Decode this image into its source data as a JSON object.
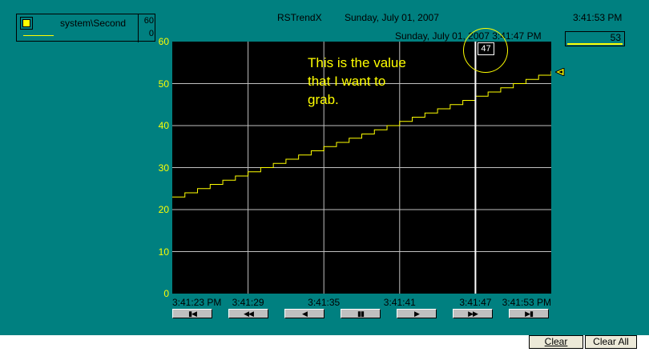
{
  "header": {
    "title": "RSTrendX",
    "date": "Sunday, July 01, 2007",
    "current_time": "3:41:53 PM",
    "cursor_timestamp": "Sunday, July 01, 2007 3:41:47 PM"
  },
  "legend": {
    "tag_name": "system\\Second",
    "scale_max": "60",
    "scale_min": "0",
    "pen_color": "#ffff00"
  },
  "current_value": "53",
  "cursor_value": "47",
  "annotation": [
    "This is the value",
    "that I want to",
    "grab."
  ],
  "y_axis_labels": [
    "60",
    "50",
    "40",
    "30",
    "20",
    "10",
    "0"
  ],
  "x_axis_labels": [
    "3:41:23 PM",
    "3:41:29",
    "3:41:35",
    "3:41:41",
    "3:41:47",
    "3:41:53 PM"
  ],
  "nav_buttons": [
    {
      "name": "first-page-button",
      "icon": "skip-to-start-icon"
    },
    {
      "name": "page-back-button",
      "icon": "fast-rewind-icon"
    },
    {
      "name": "step-back-button",
      "icon": "step-back-icon"
    },
    {
      "name": "pause-button",
      "icon": "pause-icon"
    },
    {
      "name": "step-forward-button",
      "icon": "step-forward-icon"
    },
    {
      "name": "page-forward-button",
      "icon": "fast-forward-icon"
    },
    {
      "name": "last-page-button",
      "icon": "skip-to-end-icon"
    }
  ],
  "toolbar": {
    "clear_label": "Clear",
    "clear_all_label": "Clear All"
  },
  "colors": {
    "background": "#008080",
    "plot_background": "#000000",
    "trend_pen": "#ffff00",
    "grid": "#c0c0c0",
    "annotation": "#ffff00"
  },
  "chart_data": {
    "type": "line",
    "x": [
      "3:41:23",
      "3:41:24",
      "3:41:25",
      "3:41:26",
      "3:41:27",
      "3:41:28",
      "3:41:29",
      "3:41:30",
      "3:41:31",
      "3:41:32",
      "3:41:33",
      "3:41:34",
      "3:41:35",
      "3:41:36",
      "3:41:37",
      "3:41:38",
      "3:41:39",
      "3:41:40",
      "3:41:41",
      "3:41:42",
      "3:41:43",
      "3:41:44",
      "3:41:45",
      "3:41:46",
      "3:41:47",
      "3:41:48",
      "3:41:49",
      "3:41:50",
      "3:41:51",
      "3:41:52",
      "3:41:53"
    ],
    "series": [
      {
        "name": "system\\Second",
        "values": [
          23,
          24,
          25,
          26,
          27,
          28,
          29,
          30,
          31,
          32,
          33,
          34,
          35,
          36,
          37,
          38,
          39,
          40,
          41,
          42,
          43,
          44,
          45,
          46,
          47,
          48,
          49,
          50,
          51,
          52,
          53
        ]
      }
    ],
    "ylim": [
      0,
      60
    ],
    "grid": true,
    "step": true,
    "cursor_x": "3:41:47"
  }
}
